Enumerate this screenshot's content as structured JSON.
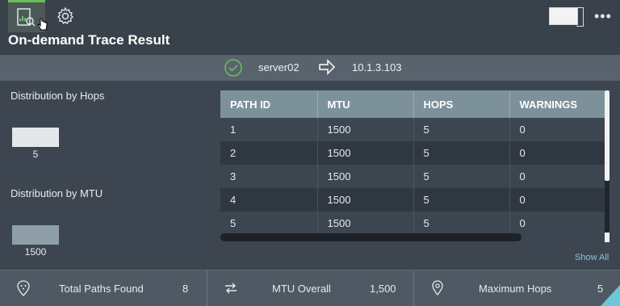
{
  "header": {
    "title": "On-demand Trace Result",
    "toolbar": {
      "active_tool": "trace-report-icon",
      "settings": "gear-icon",
      "more": "•••"
    }
  },
  "route": {
    "source": "server02",
    "destination": "10.1.3.103",
    "status_color": "#6bbf58"
  },
  "hops_distribution": {
    "title": "Distribution by Hops",
    "bars": [
      {
        "label": "5",
        "count": 8
      }
    ]
  },
  "mtu_distribution": {
    "title": "Distribution by MTU",
    "bars": [
      {
        "label": "1500",
        "count": 8
      }
    ]
  },
  "paths_table": {
    "columns": [
      "PATH ID",
      "MTU",
      "HOPS",
      "WARNINGS"
    ],
    "rows": [
      [
        "1",
        "1500",
        "5",
        "0"
      ],
      [
        "2",
        "1500",
        "5",
        "0"
      ],
      [
        "3",
        "1500",
        "5",
        "0"
      ],
      [
        "4",
        "1500",
        "5",
        "0"
      ],
      [
        "5",
        "1500",
        "5",
        "0"
      ]
    ],
    "show_all_label": "Show All"
  },
  "footer": {
    "total_paths": {
      "label": "Total Paths Found",
      "value": "8"
    },
    "mtu_overall": {
      "label": "MTU Overall",
      "value": "1,500"
    },
    "max_hops": {
      "label": "Maximum Hops",
      "value": "5"
    }
  }
}
